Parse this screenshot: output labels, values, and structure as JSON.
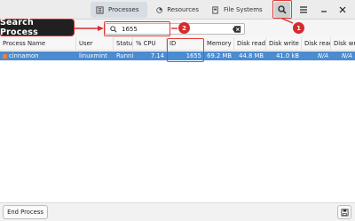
{
  "header": {
    "tabs": [
      {
        "label": "Processes",
        "icon": "processes-icon",
        "active": true
      },
      {
        "label": "Resources",
        "icon": "resources-icon",
        "active": false
      },
      {
        "label": "File Systems",
        "icon": "file-systems-icon",
        "active": false
      }
    ]
  },
  "search": {
    "value": "1655"
  },
  "table": {
    "columns": [
      "Process Name",
      "User",
      "Status",
      "% CPU",
      "ID",
      "Memory",
      "Disk read",
      "Disk write",
      "Disk read",
      "Disk write"
    ],
    "rows": [
      {
        "name": "cinnamon",
        "user": "linuxmint",
        "status": "Runni",
        "cpu": "7.14",
        "id": "1655",
        "memory": "69.2 MB",
        "disk_read_total": "44.8 MB",
        "disk_write_total": "41.0 kB",
        "disk_read": "N/A",
        "disk_write": "N/A"
      }
    ]
  },
  "footer": {
    "end_process_label": "End Process"
  },
  "annotations": {
    "callout_text": "Search Process",
    "badges": [
      "1",
      "2"
    ],
    "highlight_color": "#e53935"
  },
  "colors": {
    "selection": "#4a8bd1",
    "accent": "#d62b2b"
  }
}
